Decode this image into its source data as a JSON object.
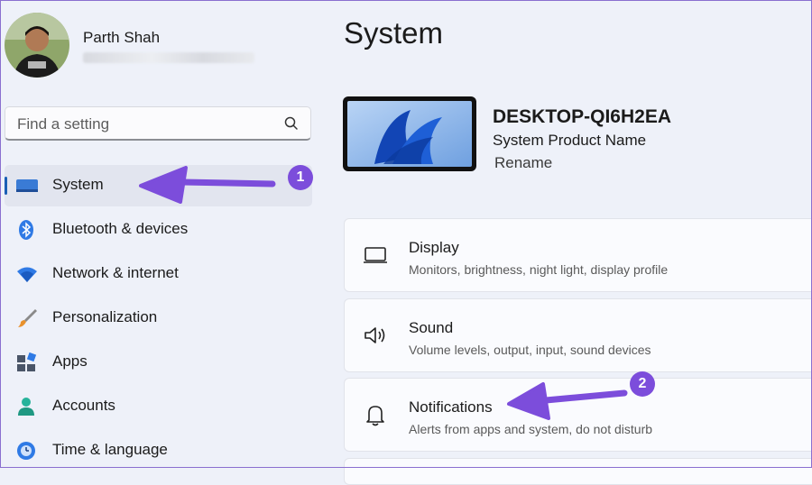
{
  "user": {
    "name": "Parth Shah"
  },
  "search": {
    "placeholder": "Find a setting"
  },
  "nav": {
    "items": [
      {
        "label": "System",
        "icon": "monitor-icon",
        "selected": true
      },
      {
        "label": "Bluetooth & devices",
        "icon": "bluetooth-icon"
      },
      {
        "label": "Network & internet",
        "icon": "wifi-icon"
      },
      {
        "label": "Personalization",
        "icon": "brush-icon"
      },
      {
        "label": "Apps",
        "icon": "apps-icon"
      },
      {
        "label": "Accounts",
        "icon": "person-icon"
      },
      {
        "label": "Time & language",
        "icon": "globe-clock-icon"
      }
    ]
  },
  "page": {
    "title": "System"
  },
  "device": {
    "name": "DESKTOP-QI6H2EA",
    "model": "System Product Name",
    "rename_label": "Rename"
  },
  "cards": [
    {
      "title": "Display",
      "subtitle": "Monitors, brightness, night light, display profile",
      "icon": "display-icon"
    },
    {
      "title": "Sound",
      "subtitle": "Volume levels, output, input, sound devices",
      "icon": "speaker-icon"
    },
    {
      "title": "Notifications",
      "subtitle": "Alerts from apps and system, do not disturb",
      "icon": "bell-icon"
    }
  ],
  "annotations": [
    {
      "number": "1",
      "target": "System"
    },
    {
      "number": "2",
      "target": "Notifications"
    }
  ],
  "colors": {
    "accent": "#1a5fb4",
    "annotation": "#7c4ddb",
    "background": "#eef1f9"
  }
}
